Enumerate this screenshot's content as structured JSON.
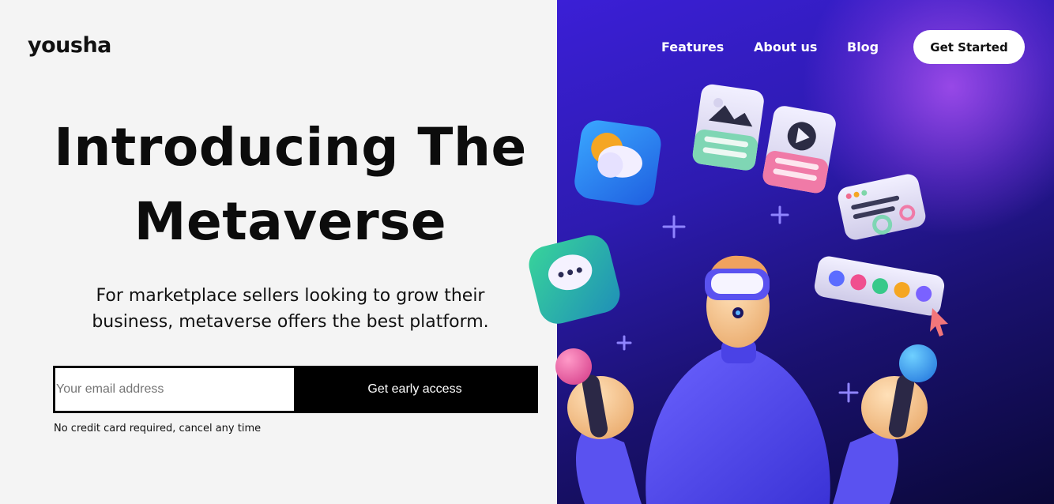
{
  "brand": {
    "logo": "yousha"
  },
  "nav": {
    "links": [
      "Features",
      "About us",
      "Blog"
    ],
    "cta": "Get Started"
  },
  "hero": {
    "headline_line1": "Introducing The",
    "headline_line2": "Metaverse",
    "subtitle_line1": "For marketplace sellers looking to grow their",
    "subtitle_line2": "business, metaverse offers the best platform.",
    "email_placeholder": "Your email address",
    "email_value": "",
    "submit_label": "Get early access",
    "note": "No credit card required, cancel any time"
  },
  "illustration": {
    "icons": [
      "weather-app-icon",
      "chat-app-icon",
      "image-card-icon",
      "video-card-icon",
      "settings-card-icon",
      "color-palette-card-icon",
      "cursor-icon",
      "plus-sparkle-icon"
    ],
    "character": "vr-headset-character"
  },
  "colors": {
    "left_bg": "#f4f4f4",
    "hero_gradient_start": "#3b1fd6",
    "hero_gradient_end": "#0a0838",
    "accent_purple": "#9b4de8",
    "text": "#0c0c0c"
  }
}
